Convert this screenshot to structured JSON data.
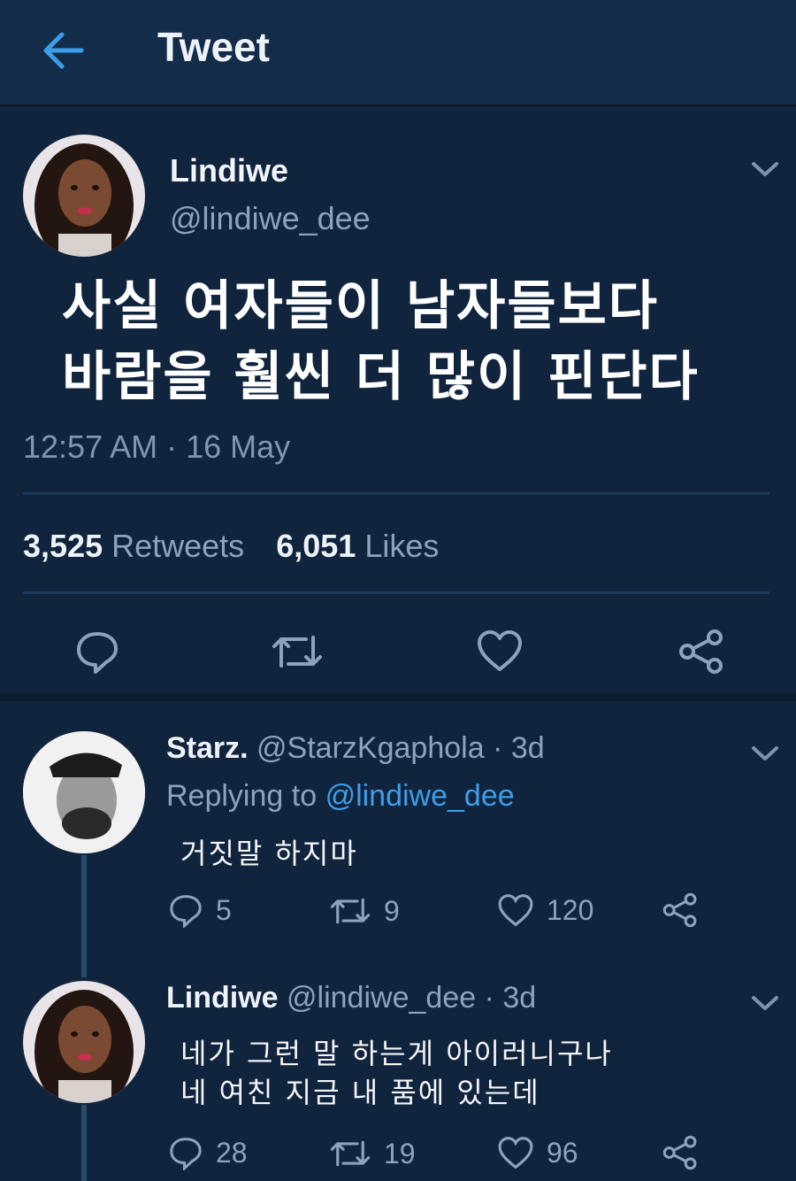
{
  "header": {
    "title": "Tweet",
    "back_icon": "arrow-left-icon"
  },
  "tweet": {
    "author_name": "Lindiwe",
    "author_handle": "@lindiwe_dee",
    "text": "사실 여자들이 남자들보다\n바람을 훨씬 더 많이 핀단다",
    "timestamp": "12:57 AM · 16 May",
    "retweets_count": "3,525",
    "retweets_label": "Retweets",
    "likes_count": "6,051",
    "likes_label": "Likes"
  },
  "replies": [
    {
      "name": "Starz.",
      "meta": "@StarzKgaphola · 3d",
      "replying_prefix": "Replying to",
      "replying_handle": "@lindiwe_dee",
      "text": "거짓말 하지마",
      "replies_count": "5",
      "retweets_count": "9",
      "likes_count": "120"
    },
    {
      "name": "Lindiwe",
      "meta": "@lindiwe_dee · 3d",
      "text": "네가 그런 말 하는게 아이러니구나\n네 여친 지금 내 품에 있는데",
      "replies_count": "28",
      "retweets_count": "19",
      "likes_count": "96"
    }
  ],
  "colors": {
    "background": "#10243d",
    "header": "#132c4a",
    "accent": "#3d9ee8",
    "muted": "#8ea3ba"
  }
}
